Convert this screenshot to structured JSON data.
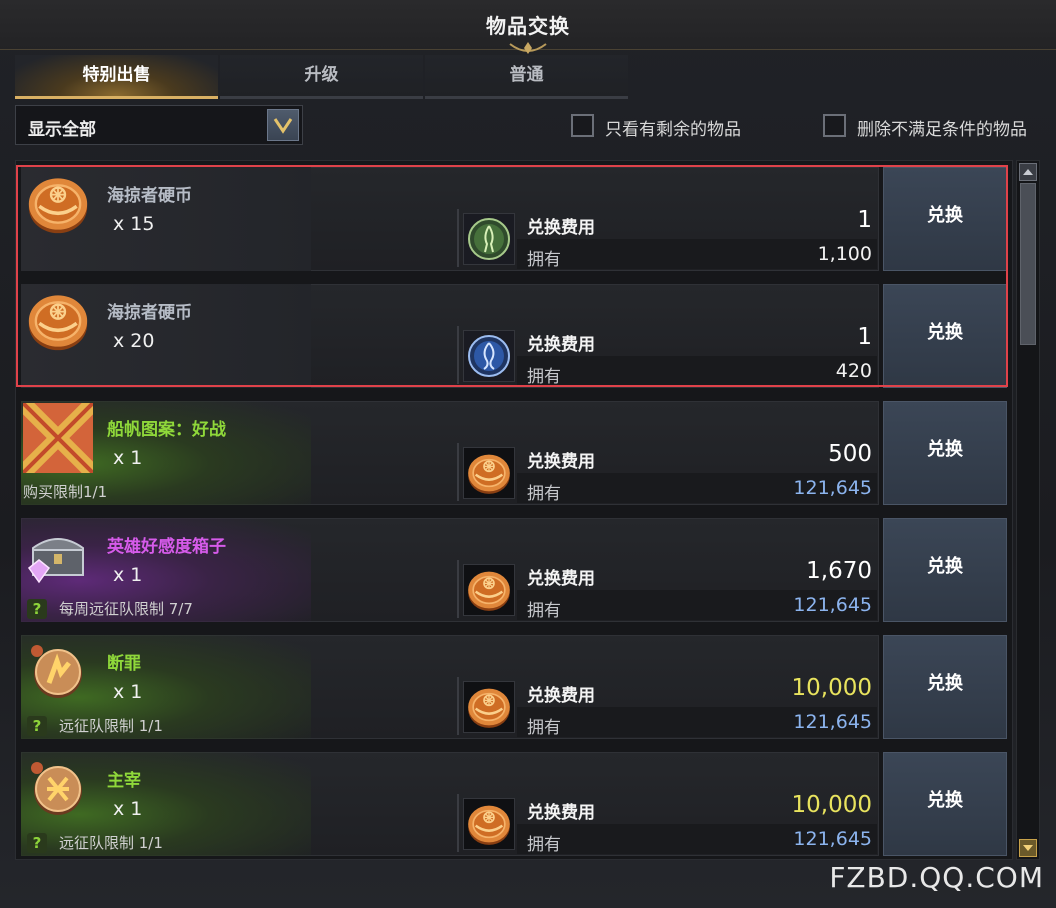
{
  "window": {
    "title": "物品交换"
  },
  "tabs": [
    {
      "label": "特别出售",
      "active": true
    },
    {
      "label": "升级",
      "active": false
    },
    {
      "label": "普通",
      "active": false
    }
  ],
  "filter": {
    "dropdown_value": "显示全部",
    "checkbox_remaining": {
      "label": "只看有剩余的物品",
      "checked": false
    },
    "checkbox_hide_unmet": {
      "label": "删除不满足条件的物品",
      "checked": false
    }
  },
  "items": [
    {
      "name": "海掠者硬币",
      "qty": "x 15",
      "limit": "",
      "icon": "pirate-coin-icon",
      "cost_icon": "green-spirit-token-icon",
      "cost_label": "兑换费用",
      "cost": "1",
      "own_label": "拥有",
      "owned": "1,100",
      "button": "兑换",
      "name_color": "#b6bcc6"
    },
    {
      "name": "海掠者硬币",
      "qty": "x 20",
      "limit": "",
      "icon": "pirate-coin-icon",
      "cost_icon": "blue-spirit-token-icon",
      "cost_label": "兑换费用",
      "cost": "1",
      "own_label": "拥有",
      "owned": "420",
      "button": "兑换",
      "name_color": "#b6bcc6"
    },
    {
      "name": "船帆图案：好战",
      "qty": "x 1",
      "limit": "购买限制1/1",
      "icon": "sail-pattern-icon",
      "cost_icon": "pirate-coin-icon",
      "cost_label": "兑换费用",
      "cost": "500",
      "own_label": "拥有",
      "owned": "121,645",
      "button": "兑换",
      "name_color": "#8fd83a"
    },
    {
      "name": "英雄好感度箱子",
      "qty": "x 1",
      "limit": "每周远征队限制 7/7",
      "icon": "treasure-chest-icon",
      "cost_icon": "pirate-coin-icon",
      "cost_label": "兑换费用",
      "cost": "1,670",
      "own_label": "拥有",
      "owned": "121,645",
      "button": "兑换",
      "name_color": "#d65bea"
    },
    {
      "name": "断罪",
      "qty": "x 1",
      "limit": "远征队限制 1/1",
      "icon": "rune-conviction-icon",
      "cost_icon": "pirate-coin-icon",
      "cost_label": "兑换费用",
      "cost": "10,000",
      "own_label": "拥有",
      "owned": "121,645",
      "button": "兑换",
      "name_color": "#8fd83a"
    },
    {
      "name": "主宰",
      "qty": "x 1",
      "limit": "远征队限制 1/1",
      "icon": "rune-dominion-icon",
      "cost_icon": "pirate-coin-icon",
      "cost_label": "兑换费用",
      "cost": "10,000",
      "own_label": "拥有",
      "owned": "121,645",
      "button": "兑换",
      "name_color": "#8fd83a"
    }
  ],
  "watermark": "FZBD.QQ.COM"
}
